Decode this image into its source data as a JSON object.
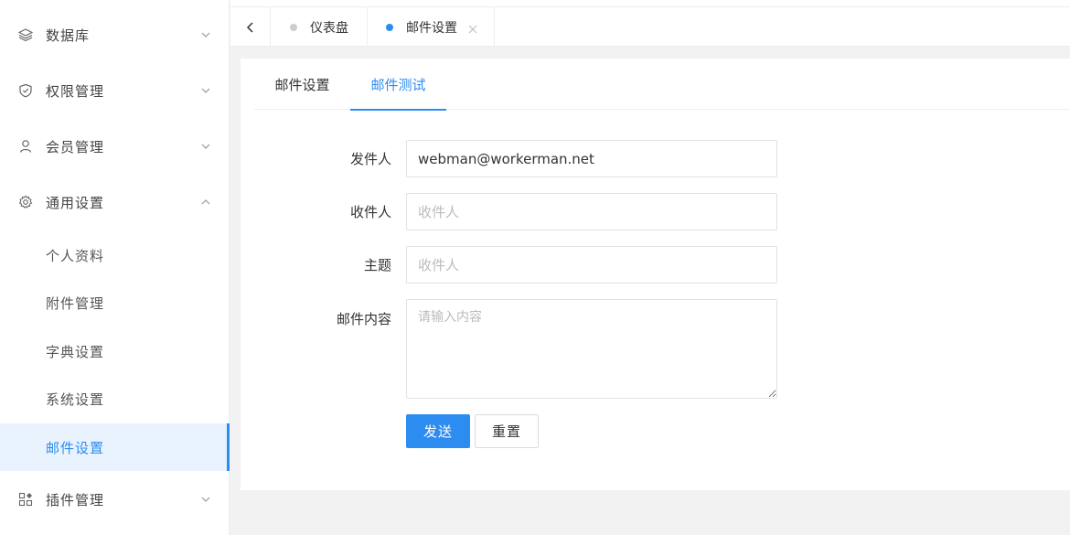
{
  "sidebar": {
    "menus": [
      {
        "label": "数据库",
        "icon": "layers-icon",
        "expanded": false
      },
      {
        "label": "权限管理",
        "icon": "shield-icon",
        "expanded": false
      },
      {
        "label": "会员管理",
        "icon": "user-icon",
        "expanded": false
      },
      {
        "label": "通用设置",
        "icon": "gear-icon",
        "expanded": true
      },
      {
        "label": "插件管理",
        "icon": "apps-icon",
        "expanded": false
      }
    ],
    "submenu": [
      {
        "label": "个人资料"
      },
      {
        "label": "附件管理"
      },
      {
        "label": "字典设置"
      },
      {
        "label": "系统设置"
      },
      {
        "label": "邮件设置",
        "active": true
      }
    ]
  },
  "tabs": [
    {
      "label": "仪表盘",
      "active": false
    },
    {
      "label": "邮件设置",
      "active": true
    }
  ],
  "subtabs": [
    {
      "label": "邮件设置",
      "active": false
    },
    {
      "label": "邮件测试",
      "active": true
    }
  ],
  "form": {
    "from": {
      "label": "发件人",
      "value": "webman@workerman.net"
    },
    "to": {
      "label": "收件人",
      "value": "",
      "placeholder": "收件人"
    },
    "subject": {
      "label": "主题",
      "value": "",
      "placeholder": "收件人"
    },
    "content": {
      "label": "邮件内容",
      "value": "",
      "placeholder": "请输入内容"
    }
  },
  "buttons": {
    "send": "发送",
    "reset": "重置"
  },
  "colors": {
    "accent": "#2d8cf0",
    "active_bg": "#e8f3fe"
  }
}
